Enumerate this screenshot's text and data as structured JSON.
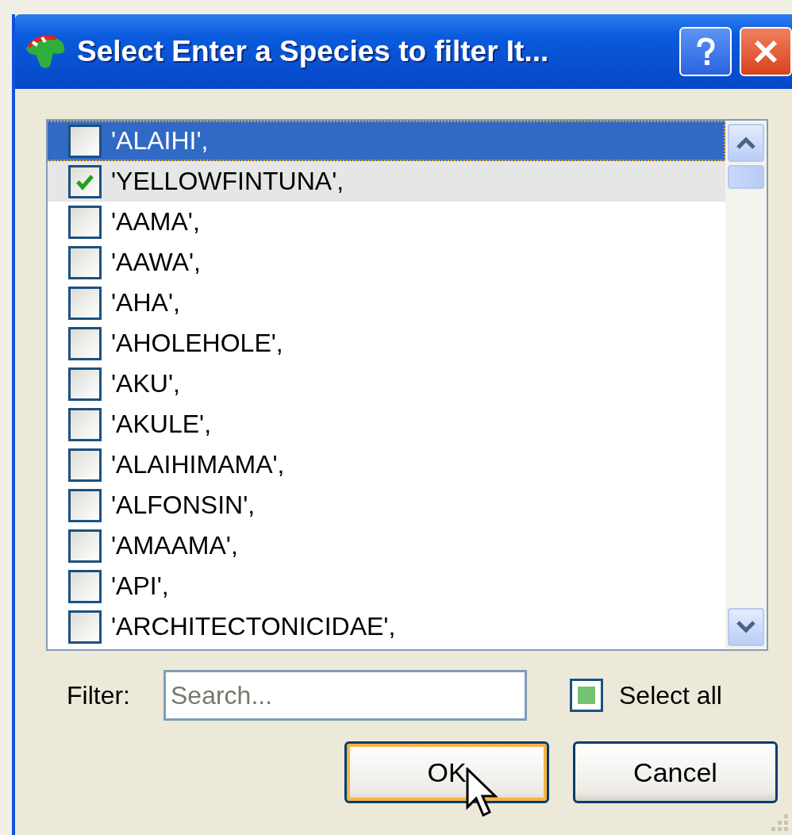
{
  "window": {
    "title": "Select Enter a Species to filter It..."
  },
  "items": [
    {
      "label": "'ALAIHI',",
      "checked": false,
      "selected": true,
      "highlighted": false
    },
    {
      "label": "'YELLOWFINTUNA',",
      "checked": true,
      "selected": false,
      "highlighted": true
    },
    {
      "label": "'AAMA',",
      "checked": false,
      "selected": false,
      "highlighted": false
    },
    {
      "label": "'AAWA',",
      "checked": false,
      "selected": false,
      "highlighted": false
    },
    {
      "label": "'AHA',",
      "checked": false,
      "selected": false,
      "highlighted": false
    },
    {
      "label": "'AHOLEHOLE',",
      "checked": false,
      "selected": false,
      "highlighted": false
    },
    {
      "label": "'AKU',",
      "checked": false,
      "selected": false,
      "highlighted": false
    },
    {
      "label": "'AKULE',",
      "checked": false,
      "selected": false,
      "highlighted": false
    },
    {
      "label": "'ALAIHIMAMA',",
      "checked": false,
      "selected": false,
      "highlighted": false
    },
    {
      "label": "'ALFONSIN',",
      "checked": false,
      "selected": false,
      "highlighted": false
    },
    {
      "label": "'AMAAMA',",
      "checked": false,
      "selected": false,
      "highlighted": false
    },
    {
      "label": "'API',",
      "checked": false,
      "selected": false,
      "highlighted": false
    },
    {
      "label": "'ARCHITECTONICIDAE',",
      "checked": false,
      "selected": false,
      "highlighted": false
    }
  ],
  "filter": {
    "label": "Filter:",
    "placeholder": "Search..."
  },
  "select_all": {
    "label": "Select all",
    "checked": false,
    "indeterminate": true
  },
  "buttons": [
    {
      "label": "OK",
      "default": true
    },
    {
      "label": "Cancel",
      "default": false
    }
  ]
}
